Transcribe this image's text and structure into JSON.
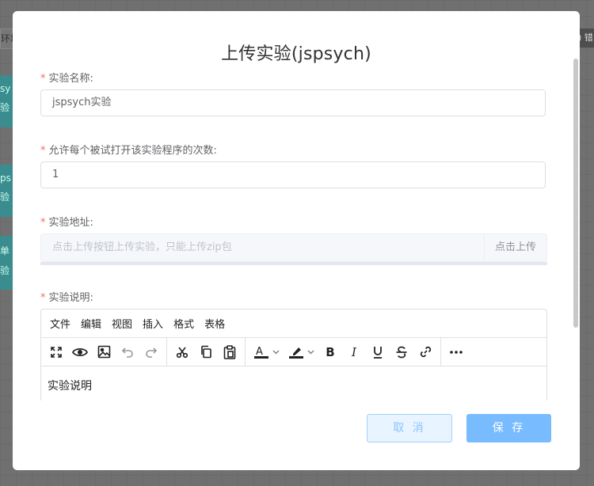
{
  "background": {
    "left_field": "环境",
    "right_button": ") 错",
    "cards": [
      {
        "line1": "sy",
        "line2": "验"
      },
      {
        "line1": "ps",
        "line2": "验"
      },
      {
        "line1": "单",
        "line2": "验"
      }
    ]
  },
  "modal": {
    "title": "上传实验(jspsych)",
    "fields": {
      "name": {
        "label": "实验名称:",
        "value": "jspsych实验"
      },
      "times": {
        "label": "允许每个被试打开该实验程序的次数:",
        "value": "1"
      },
      "address": {
        "label": "实验地址:",
        "placeholder": "点击上传按钮上传实验，只能上传zip包",
        "button": "点击上传"
      },
      "description": {
        "label": "实验说明:"
      }
    },
    "editor": {
      "menus": [
        "文件",
        "编辑",
        "视图",
        "插入",
        "格式",
        "表格"
      ],
      "toolbar_icons": [
        "fullscreen-icon",
        "preview-icon",
        "image-icon",
        "undo-icon",
        "redo-icon",
        "cut-icon",
        "copy-icon",
        "paste-icon",
        "text-color-icon",
        "highlight-icon",
        "bold-icon",
        "italic-icon",
        "underline-icon",
        "strikethrough-icon",
        "link-icon",
        "more-icon"
      ],
      "content": "实验说明"
    },
    "footer": {
      "cancel": "取 消",
      "save": "保 存"
    },
    "required_mark": "*"
  },
  "colors": {
    "primary_light": "#79bbff",
    "required": "#f56c6c"
  }
}
